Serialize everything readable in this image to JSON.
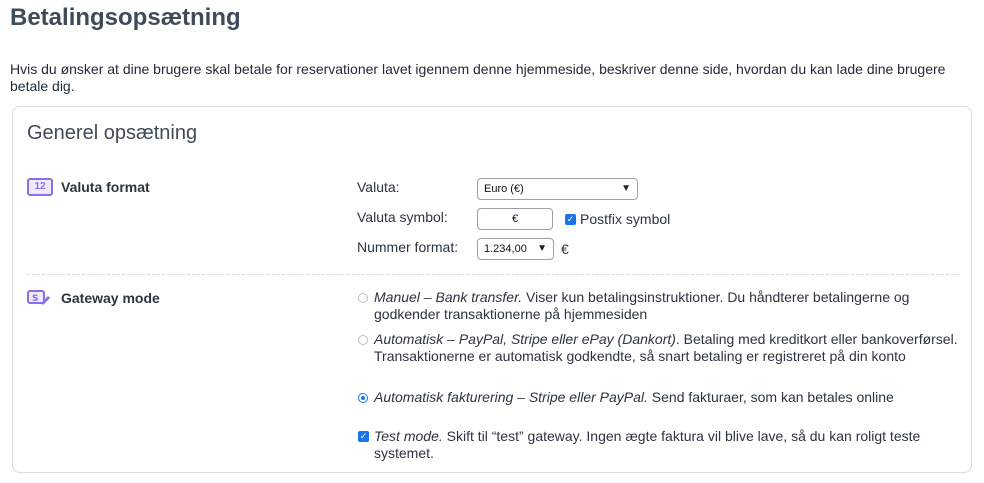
{
  "page": {
    "title": "Betalingsopsætning",
    "intro": "Hvis du ønsker at dine brugere skal betale for reservationer lavet igennem denne hjemmeside, beskriver denne side, hvordan du kan lade dine brugere betale dig."
  },
  "panel": {
    "title": "Generel opsætning",
    "currency_section": {
      "label": "Valuta format",
      "icon_text": "12",
      "currency_label": "Valuta:",
      "currency_value": "Euro (€)",
      "symbol_label": "Valuta symbol:",
      "symbol_value": "€",
      "postfix_label": "Postfix symbol",
      "number_label": "Nummer format:",
      "number_value": "1.234,00",
      "number_suffix": "€"
    },
    "gateway_section": {
      "label": "Gateway mode",
      "options": [
        {
          "title": "Manuel – Bank transfer.",
          "desc": " Viser kun betalingsinstruktioner. Du håndterer betalingerne og godkender transaktionerne på hjemmesiden",
          "selected": false
        },
        {
          "title": "Automatisk – PayPal, Stripe eller ePay (Dankort)",
          "desc": ". Betaling med kreditkort eller bankoverførsel. Transaktionerne er automatisk godkendte, så snart betaling er registreret på din konto",
          "selected": false
        },
        {
          "title": "Automatisk fakturering – Stripe eller PayPal.",
          "desc": " Send fakturaer, som kan betales online",
          "selected": true
        }
      ],
      "test_mode_title": "Test mode.",
      "test_mode_desc": " Skift til “test” gateway. Ingen ægte faktura vil blive lave, så du kan roligt teste systemet."
    }
  }
}
